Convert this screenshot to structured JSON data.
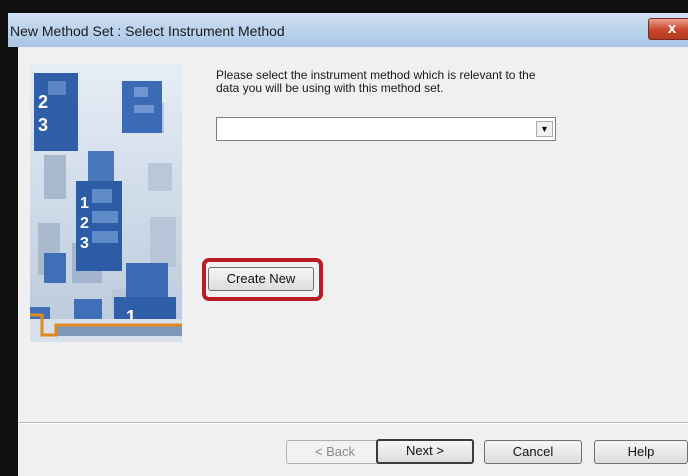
{
  "dialog": {
    "title": "New Method Set : Select Instrument Method",
    "close_glyph": "x",
    "instruction": "Please select the instrument method which is relevant to the data you will be using with this method set.",
    "instrument_method": {
      "selected": "",
      "dropdown_arrow": "▼"
    },
    "create_new_label": "Create New",
    "buttons": {
      "back": "< Back",
      "next": "Next >",
      "cancel": "Cancel",
      "help": "Help"
    }
  },
  "art_numbers": {
    "large": [
      "2",
      "3"
    ],
    "center": [
      "1",
      "2",
      "3"
    ],
    "bottom": "1",
    "small": [
      "1",
      "2",
      "3"
    ]
  },
  "colors": {
    "highlight": "#b81d25",
    "titlebar": "#b9d1ea",
    "close": "#c8452c",
    "art_blue": "#2e5fa8",
    "art_orange": "#e08a1e"
  }
}
